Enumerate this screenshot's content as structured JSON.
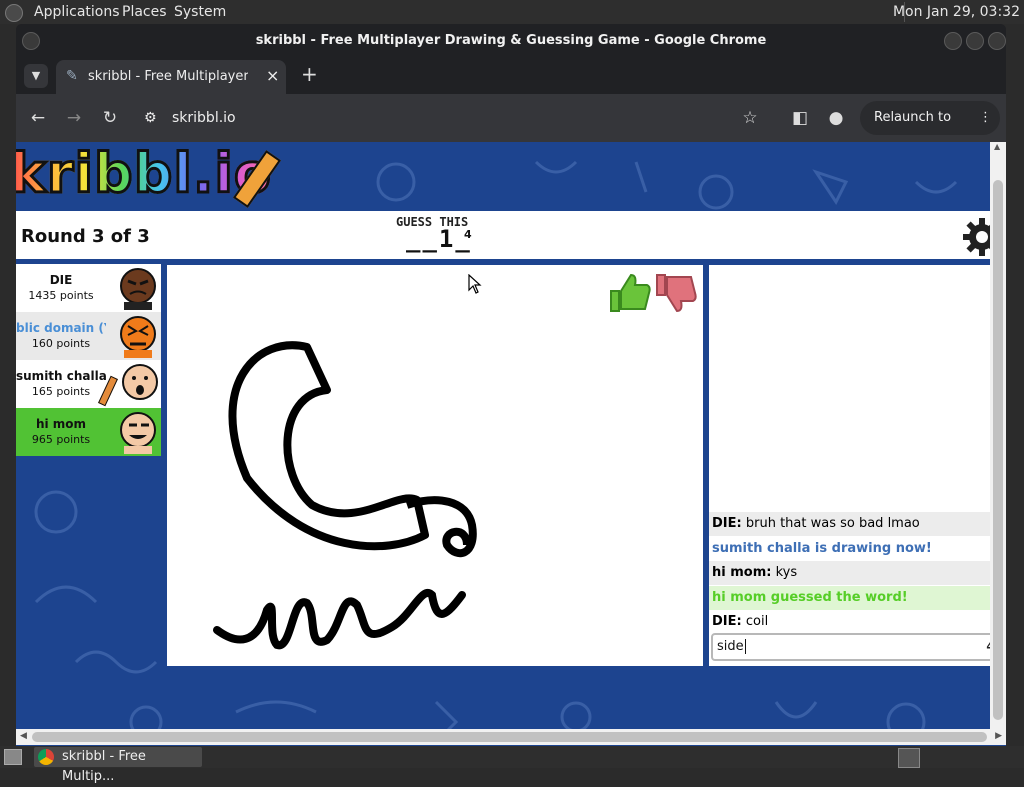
{
  "os": {
    "menus": [
      "Applications",
      "Places",
      "System"
    ],
    "clock": "Mon Jan 29, 03:32"
  },
  "window": {
    "title": "skribbl - Free Multiplayer Drawing & Guessing Game - Google Chrome"
  },
  "tab": {
    "title": "skribbl - Free Multiplayer Dra",
    "close": "×",
    "new_tab": "+"
  },
  "toolbar": {
    "url": "skribbl.io",
    "relaunch_label": "Relaunch to update"
  },
  "game": {
    "logo_text": "kribbl.io",
    "round_text": "Round 3 of 3",
    "guess_label": "GUESS THIS",
    "word_hint": "__1_",
    "word_length": "4"
  },
  "players": [
    {
      "name": "DIE",
      "points": "1435 points",
      "color": "#ffffff"
    },
    {
      "name": "blic domain (You",
      "points": "160 points",
      "color": "#e9e9e9",
      "name_color": "#4a8fd6"
    },
    {
      "name": "sumith challa",
      "points": "165 points",
      "color": "#ffffff",
      "drawing": true
    },
    {
      "name": "hi mom",
      "points": "965 points",
      "color": "#51c234"
    }
  ],
  "chat": {
    "messages": [
      {
        "author": "DIE:",
        "text": "bruh that was so bad lmao",
        "type": "normal"
      },
      {
        "author": "",
        "text": "sumith challa is drawing now!",
        "type": "system-blue"
      },
      {
        "author": "hi mom:",
        "text": "kys",
        "type": "normal"
      },
      {
        "author": "",
        "text": "hi mom guessed the word!",
        "type": "system-green"
      },
      {
        "author": "DIE:",
        "text": "coil",
        "type": "normal"
      }
    ],
    "input_value": "side",
    "input_count": "4"
  },
  "taskbar": {
    "item_label": "skribbl - Free Multip..."
  },
  "colors": {
    "page_bg": "#1d448f",
    "guessed_green": "#51c234",
    "system_blue": "#3e6fb5",
    "system_green": "#56ce27"
  }
}
